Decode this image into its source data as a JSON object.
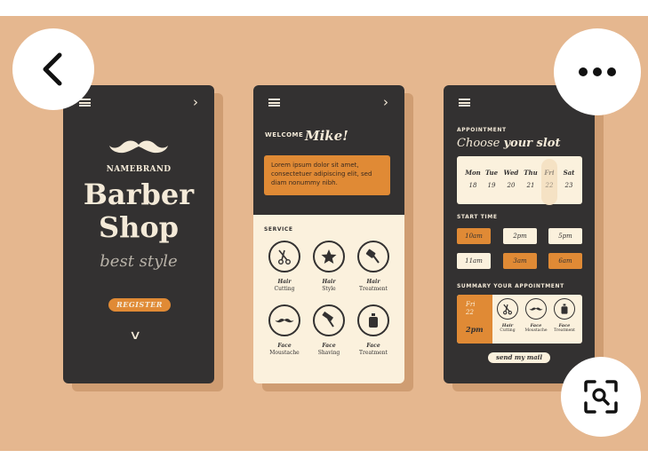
{
  "colors": {
    "background_peach": "#e5b78f",
    "phone_dark": "#333131",
    "phone_cream": "#fbf1dd",
    "accent_orange": "#e08a35"
  },
  "controls": {
    "back_icon": "arrow-left-icon",
    "more_icon": "more-dots-icon",
    "lens_icon": "image-search-icon"
  },
  "screen1": {
    "brand": "NAMEBRAND",
    "title_line1": "Barber",
    "title_line2": "Shop",
    "tagline": "best style",
    "register_label": "REGISTER"
  },
  "screen2": {
    "welcome": "WELCOME",
    "name": "Mike!",
    "message": "Lorem ipsum dolor sit amet, consectetuer adipiscing elit, sed diam nonummy nibh.",
    "service_heading": "SERVICE",
    "services": [
      {
        "title": "Hair",
        "subtitle": "Cutting",
        "icon": "scissors-icon"
      },
      {
        "title": "Hair",
        "subtitle": "Style",
        "icon": "star-icon"
      },
      {
        "title": "Hair",
        "subtitle": "Treatment",
        "icon": "brush-icon"
      },
      {
        "title": "Face",
        "subtitle": "Moustache",
        "icon": "moustache-icon"
      },
      {
        "title": "Face",
        "subtitle": "Shaving",
        "icon": "razor-icon"
      },
      {
        "title": "Face",
        "subtitle": "Treatment",
        "icon": "bottle-icon"
      }
    ]
  },
  "screen3": {
    "appointment_heading": "APPOINTMENT",
    "choose_prefix": "Choose",
    "choose_bold": "your slot",
    "calendar": [
      {
        "day": "Mon",
        "date": "18"
      },
      {
        "day": "Tue",
        "date": "19"
      },
      {
        "day": "Wed",
        "date": "20"
      },
      {
        "day": "Thu",
        "date": "21"
      },
      {
        "day": "Fri",
        "date": "22"
      },
      {
        "day": "Sat",
        "date": "23"
      }
    ],
    "selected_day": "Fri",
    "start_time_heading": "START TIME",
    "times": [
      {
        "label": "10am",
        "selected": true
      },
      {
        "label": "2pm",
        "selected": false
      },
      {
        "label": "5pm",
        "selected": false
      },
      {
        "label": "11am",
        "selected": false
      },
      {
        "label": "3am",
        "selected": true
      },
      {
        "label": "6am",
        "selected": true
      }
    ],
    "summary_heading": "SUMMARY YOUR APPOINTMENT",
    "summary_day": "Fri",
    "summary_date": "22",
    "summary_time": "2pm",
    "summary_services": [
      {
        "title": "Hair",
        "subtitle": "Cutting",
        "icon": "scissors-icon"
      },
      {
        "title": "Face",
        "subtitle": "Moustache",
        "icon": "moustache-icon"
      },
      {
        "title": "Face",
        "subtitle": "Treatment",
        "icon": "bottle-icon"
      }
    ],
    "send_label": "send my mail"
  }
}
